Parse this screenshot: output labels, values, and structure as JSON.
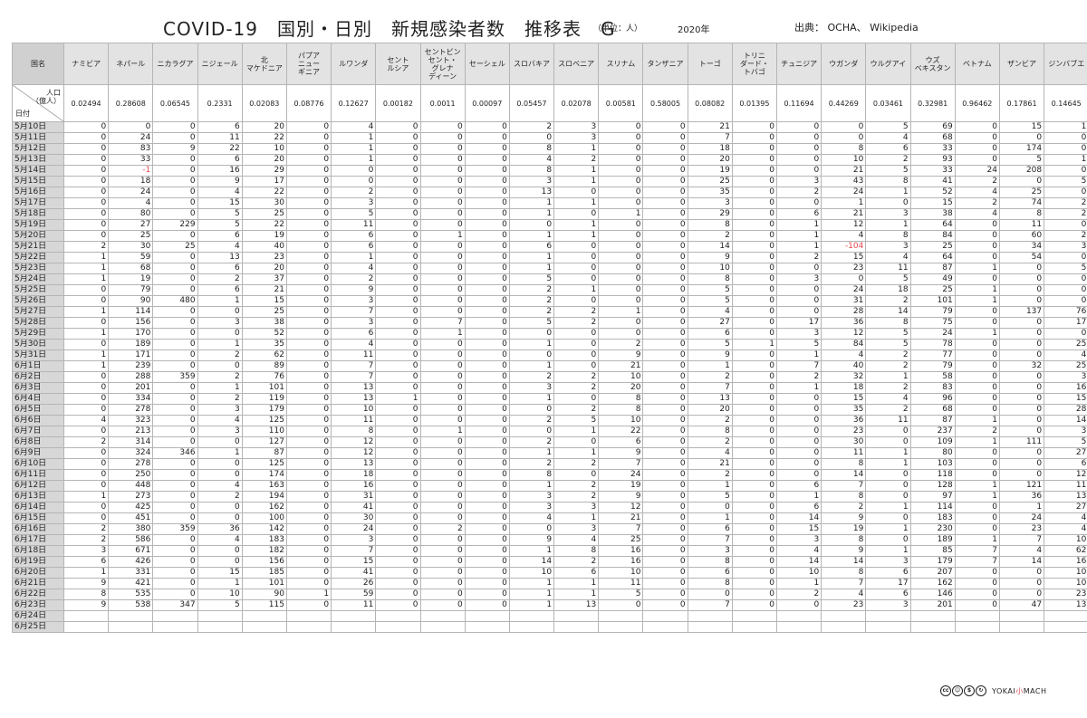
{
  "header": {
    "title": "COVID-19　国別・日別　新規感染者数　推移表　G",
    "unit": "（単位：人）",
    "year": "2020年",
    "source": "出典：  OCHA、 Wikipedia"
  },
  "table": {
    "corner_label": "国名",
    "pop_label": "人口\n（億人）",
    "date_label": "日付",
    "countries": [
      "ナミビア",
      "ネパール",
      "ニカラグア",
      "ニジェール",
      "北\nマケドニア",
      "パプア\nニュー\nギニア",
      "ルワンダ",
      "セント\nルシア",
      "セントビン\nセント・\nグレナ\nディーン",
      "セーシェル",
      "スロバキア",
      "スロベニア",
      "スリナム",
      "タンザニア",
      "トーゴ",
      "トリニ\nダード・\nトバゴ",
      "チュニジア",
      "ウガンダ",
      "ウルグアイ",
      "ウズ\nベキスタン",
      "ベトナム",
      "ザンビア",
      "ジンバブエ"
    ],
    "population": [
      "0.02494",
      "0.28608",
      "0.06545",
      "0.2331",
      "0.02083",
      "0.08776",
      "0.12627",
      "0.00182",
      "0.0011",
      "0.00097",
      "0.05457",
      "0.02078",
      "0.00581",
      "0.58005",
      "0.08082",
      "0.01395",
      "0.11694",
      "0.44269",
      "0.03461",
      "0.32981",
      "0.96462",
      "0.17861",
      "0.14645"
    ],
    "rows": [
      [
        "5月10日",
        0,
        0,
        0,
        6,
        20,
        0,
        4,
        0,
        0,
        0,
        2,
        3,
        0,
        0,
        21,
        0,
        0,
        0,
        5,
        69,
        0,
        15,
        1
      ],
      [
        "5月11日",
        0,
        24,
        0,
        11,
        22,
        0,
        1,
        0,
        0,
        0,
        0,
        3,
        0,
        0,
        7,
        0,
        0,
        0,
        4,
        68,
        0,
        0,
        0
      ],
      [
        "5月12日",
        0,
        83,
        9,
        22,
        10,
        0,
        1,
        0,
        0,
        0,
        8,
        1,
        0,
        0,
        18,
        0,
        0,
        8,
        6,
        33,
        0,
        174,
        0
      ],
      [
        "5月13日",
        0,
        33,
        0,
        6,
        20,
        0,
        1,
        0,
        0,
        0,
        4,
        2,
        0,
        0,
        20,
        0,
        0,
        10,
        2,
        93,
        0,
        5,
        1
      ],
      [
        "5月14日",
        0,
        -1,
        0,
        16,
        29,
        0,
        0,
        0,
        0,
        0,
        8,
        1,
        0,
        0,
        19,
        0,
        0,
        21,
        5,
        33,
        24,
        208,
        0
      ],
      [
        "5月15日",
        0,
        18,
        0,
        9,
        17,
        0,
        0,
        0,
        0,
        0,
        3,
        1,
        0,
        0,
        25,
        0,
        3,
        43,
        8,
        41,
        2,
        0,
        5
      ],
      [
        "5月16日",
        0,
        24,
        0,
        4,
        22,
        0,
        2,
        0,
        0,
        0,
        13,
        0,
        0,
        0,
        35,
        0,
        2,
        24,
        1,
        52,
        4,
        25,
        0
      ],
      [
        "5月17日",
        0,
        4,
        0,
        15,
        30,
        0,
        3,
        0,
        0,
        0,
        1,
        1,
        0,
        0,
        3,
        0,
        0,
        1,
        0,
        15,
        2,
        74,
        2
      ],
      [
        "5月18日",
        0,
        80,
        0,
        5,
        25,
        0,
        5,
        0,
        0,
        0,
        1,
        0,
        1,
        0,
        29,
        0,
        6,
        21,
        3,
        38,
        4,
        8,
        2
      ],
      [
        "5月19日",
        0,
        27,
        229,
        5,
        22,
        0,
        11,
        0,
        0,
        0,
        0,
        1,
        0,
        0,
        8,
        0,
        1,
        12,
        1,
        64,
        0,
        11,
        0
      ],
      [
        "5月20日",
        0,
        25,
        0,
        6,
        19,
        0,
        6,
        0,
        1,
        0,
        1,
        1,
        0,
        0,
        2,
        0,
        1,
        4,
        8,
        84,
        0,
        60,
        2
      ],
      [
        "5月21日",
        2,
        30,
        25,
        4,
        40,
        0,
        6,
        0,
        0,
        0,
        6,
        0,
        0,
        0,
        14,
        0,
        1,
        -104,
        3,
        25,
        0,
        34,
        3
      ],
      [
        "5月22日",
        1,
        59,
        0,
        13,
        23,
        0,
        1,
        0,
        0,
        0,
        1,
        0,
        0,
        0,
        9,
        0,
        2,
        15,
        4,
        64,
        0,
        54,
        0
      ],
      [
        "5月23日",
        1,
        68,
        0,
        6,
        20,
        0,
        4,
        0,
        0,
        0,
        1,
        0,
        0,
        0,
        10,
        0,
        0,
        23,
        11,
        87,
        1,
        0,
        5
      ],
      [
        "5月24日",
        1,
        19,
        0,
        2,
        37,
        0,
        2,
        0,
        0,
        0,
        5,
        0,
        0,
        0,
        8,
        0,
        3,
        0,
        5,
        49,
        0,
        0,
        0
      ],
      [
        "5月25日",
        0,
        79,
        0,
        6,
        21,
        0,
        9,
        0,
        0,
        0,
        2,
        1,
        0,
        0,
        5,
        0,
        0,
        24,
        18,
        25,
        1,
        0,
        0
      ],
      [
        "5月26日",
        0,
        90,
        480,
        1,
        15,
        0,
        3,
        0,
        0,
        0,
        2,
        0,
        0,
        0,
        5,
        0,
        0,
        31,
        2,
        101,
        1,
        0,
        0
      ],
      [
        "5月27日",
        1,
        114,
        0,
        0,
        25,
        0,
        7,
        0,
        0,
        0,
        2,
        2,
        1,
        0,
        4,
        0,
        0,
        28,
        14,
        79,
        0,
        137,
        76
      ],
      [
        "5月28日",
        0,
        156,
        0,
        3,
        38,
        0,
        3,
        0,
        7,
        0,
        5,
        2,
        0,
        0,
        27,
        0,
        17,
        36,
        8,
        75,
        0,
        0,
        17
      ],
      [
        "5月29日",
        1,
        170,
        0,
        0,
        52,
        0,
        6,
        0,
        1,
        0,
        0,
        0,
        0,
        0,
        6,
        0,
        3,
        12,
        5,
        24,
        1,
        0,
        0
      ],
      [
        "5月30日",
        0,
        189,
        0,
        1,
        35,
        0,
        4,
        0,
        0,
        0,
        1,
        0,
        2,
        0,
        5,
        1,
        5,
        84,
        5,
        78,
        0,
        0,
        25
      ],
      [
        "5月31日",
        1,
        171,
        0,
        2,
        62,
        0,
        11,
        0,
        0,
        0,
        0,
        0,
        9,
        0,
        9,
        0,
        1,
        4,
        2,
        77,
        0,
        0,
        4
      ],
      [
        "6月1日",
        1,
        239,
        0,
        0,
        89,
        0,
        7,
        0,
        0,
        0,
        1,
        0,
        21,
        0,
        1,
        0,
        7,
        40,
        2,
        79,
        0,
        32,
        25
      ],
      [
        "6月2日",
        0,
        288,
        359,
        2,
        76,
        0,
        7,
        0,
        0,
        0,
        2,
        2,
        10,
        0,
        2,
        0,
        2,
        32,
        1,
        58,
        0,
        0,
        3
      ],
      [
        "6月3日",
        0,
        201,
        0,
        1,
        101,
        0,
        13,
        0,
        0,
        0,
        3,
        2,
        20,
        0,
        7,
        0,
        1,
        18,
        2,
        83,
        0,
        0,
        16
      ],
      [
        "6月4日",
        0,
        334,
        0,
        2,
        119,
        0,
        13,
        1,
        0,
        0,
        1,
        0,
        8,
        0,
        13,
        0,
        0,
        15,
        4,
        96,
        0,
        0,
        15
      ],
      [
        "6月5日",
        0,
        278,
        0,
        3,
        179,
        0,
        10,
        0,
        0,
        0,
        0,
        2,
        8,
        0,
        20,
        0,
        0,
        35,
        2,
        68,
        0,
        0,
        28
      ],
      [
        "6月6日",
        4,
        323,
        0,
        4,
        125,
        0,
        11,
        0,
        0,
        0,
        2,
        5,
        10,
        0,
        2,
        0,
        0,
        36,
        11,
        87,
        1,
        0,
        14
      ],
      [
        "6月7日",
        0,
        213,
        0,
        3,
        110,
        0,
        8,
        0,
        1,
        0,
        0,
        1,
        22,
        0,
        8,
        0,
        0,
        23,
        0,
        237,
        2,
        0,
        3
      ],
      [
        "6月8日",
        2,
        314,
        0,
        0,
        127,
        0,
        12,
        0,
        0,
        0,
        2,
        0,
        6,
        0,
        2,
        0,
        0,
        30,
        0,
        109,
        1,
        111,
        5
      ],
      [
        "6月9日",
        0,
        324,
        346,
        1,
        87,
        0,
        12,
        0,
        0,
        0,
        1,
        1,
        9,
        0,
        4,
        0,
        0,
        11,
        1,
        80,
        0,
        0,
        27
      ],
      [
        "6月10日",
        0,
        278,
        0,
        0,
        125,
        0,
        13,
        0,
        0,
        0,
        2,
        2,
        7,
        0,
        21,
        0,
        0,
        8,
        1,
        103,
        0,
        0,
        6
      ],
      [
        "6月11日",
        0,
        250,
        0,
        0,
        174,
        0,
        18,
        0,
        0,
        0,
        8,
        0,
        24,
        0,
        2,
        0,
        0,
        14,
        0,
        118,
        0,
        0,
        12
      ],
      [
        "6月12日",
        0,
        448,
        0,
        4,
        163,
        0,
        16,
        0,
        0,
        0,
        1,
        2,
        19,
        0,
        1,
        0,
        6,
        7,
        0,
        128,
        1,
        121,
        11
      ],
      [
        "6月13日",
        1,
        273,
        0,
        2,
        194,
        0,
        31,
        0,
        0,
        0,
        3,
        2,
        9,
        0,
        5,
        0,
        1,
        8,
        0,
        97,
        1,
        36,
        13
      ],
      [
        "6月14日",
        0,
        425,
        0,
        0,
        162,
        0,
        41,
        0,
        0,
        0,
        3,
        3,
        12,
        0,
        0,
        0,
        6,
        2,
        1,
        114,
        0,
        1,
        27
      ],
      [
        "6月15日",
        0,
        451,
        0,
        0,
        100,
        0,
        30,
        0,
        0,
        0,
        4,
        1,
        21,
        0,
        1,
        0,
        14,
        9,
        0,
        183,
        0,
        24,
        4
      ],
      [
        "6月16日",
        2,
        380,
        359,
        36,
        142,
        0,
        24,
        0,
        2,
        0,
        0,
        3,
        7,
        0,
        6,
        0,
        15,
        19,
        1,
        230,
        0,
        23,
        4
      ],
      [
        "6月17日",
        2,
        586,
        0,
        4,
        183,
        0,
        3,
        0,
        0,
        0,
        9,
        4,
        25,
        0,
        7,
        0,
        3,
        8,
        0,
        189,
        1,
        7,
        10
      ],
      [
        "6月18日",
        3,
        671,
        0,
        0,
        182,
        0,
        7,
        0,
        0,
        0,
        1,
        8,
        16,
        0,
        3,
        0,
        4,
        9,
        1,
        85,
        7,
        4,
        62
      ],
      [
        "6月19日",
        6,
        426,
        0,
        0,
        156,
        0,
        15,
        0,
        0,
        0,
        14,
        2,
        16,
        0,
        8,
        0,
        14,
        14,
        3,
        179,
        7,
        14,
        16
      ],
      [
        "6月20日",
        1,
        331,
        0,
        15,
        185,
        0,
        41,
        0,
        0,
        0,
        10,
        6,
        10,
        0,
        6,
        0,
        10,
        8,
        6,
        207,
        0,
        0,
        10
      ],
      [
        "6月21日",
        9,
        421,
        0,
        1,
        101,
        0,
        26,
        0,
        0,
        0,
        1,
        1,
        11,
        0,
        8,
        0,
        1,
        7,
        17,
        162,
        0,
        0,
        10
      ],
      [
        "6月22日",
        8,
        535,
        0,
        10,
        90,
        1,
        59,
        0,
        0,
        0,
        1,
        1,
        5,
        0,
        0,
        0,
        2,
        4,
        6,
        146,
        0,
        0,
        23
      ],
      [
        "6月23日",
        9,
        538,
        347,
        5,
        115,
        0,
        11,
        0,
        0,
        0,
        1,
        13,
        0,
        0,
        7,
        0,
        0,
        23,
        3,
        201,
        0,
        47,
        13
      ],
      [
        "6月24日"
      ],
      [
        "6月25日"
      ]
    ]
  },
  "footer": {
    "license_icons": [
      "cc",
      "by",
      "nc",
      "sa"
    ],
    "brand_left": "YOKAI",
    "brand_mid": "小",
    "brand_right": "MACH"
  }
}
